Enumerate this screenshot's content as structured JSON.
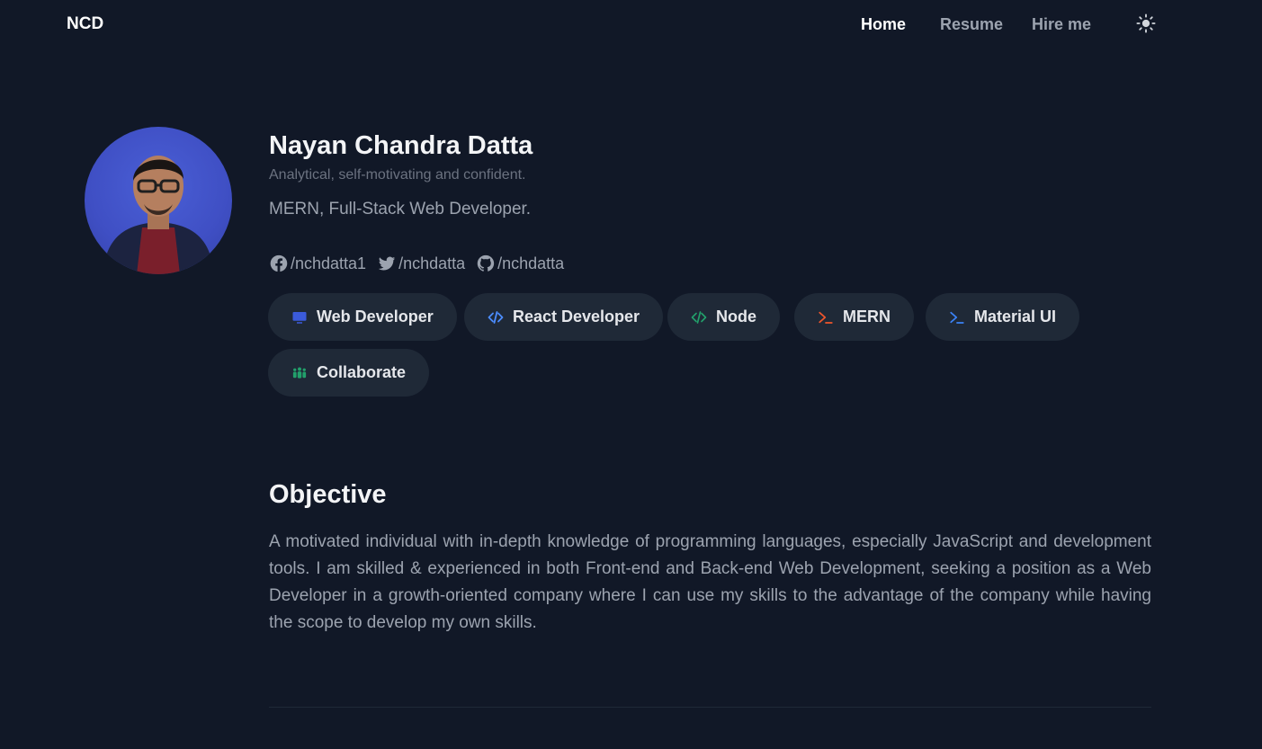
{
  "header": {
    "brand": "NCD",
    "nav": [
      {
        "label": "Home",
        "active": true
      },
      {
        "label": "Resume",
        "active": false
      },
      {
        "label": "Hire me",
        "active": false
      }
    ],
    "theme_icon": "sun-icon"
  },
  "profile": {
    "name": "Nayan Chandra Datta",
    "tagline": "Analytical, self-motivating and confident.",
    "role": "MERN, Full-Stack Web Developer.",
    "socials": [
      {
        "icon": "facebook-icon",
        "handle": "/nchdatta1"
      },
      {
        "icon": "twitter-icon",
        "handle": "/nchdatta"
      },
      {
        "icon": "github-icon",
        "handle": "/nchdatta"
      }
    ]
  },
  "skills": [
    {
      "label": "Web Developer",
      "icon": "monitor-icon",
      "color": "#3b5bdb"
    },
    {
      "label": "React Developer",
      "icon": "code-icon",
      "color": "#4c8dff"
    },
    {
      "label": "Node",
      "icon": "code-icon",
      "color": "#22a06b"
    },
    {
      "label": "MERN",
      "icon": "terminal-icon",
      "color": "#f0562c"
    },
    {
      "label": "Material UI",
      "icon": "terminal-icon",
      "color": "#3b82f6"
    },
    {
      "label": "Collaborate",
      "icon": "people-icon",
      "color": "#22a06b"
    }
  ],
  "objective": {
    "title": "Objective",
    "text": "A motivated individual with in-depth knowledge of programming languages, especially JavaScript and development tools. I am skilled & experienced in both Front-end and Back-end Web Development, seeking a position as a Web Developer in a growth-oriented company where I can use my skills to the advantage of the company while having the scope to develop my own skills."
  },
  "colors": {
    "background": "#111827",
    "chip_bg": "#1f2937",
    "text_muted": "#9ca3af"
  }
}
